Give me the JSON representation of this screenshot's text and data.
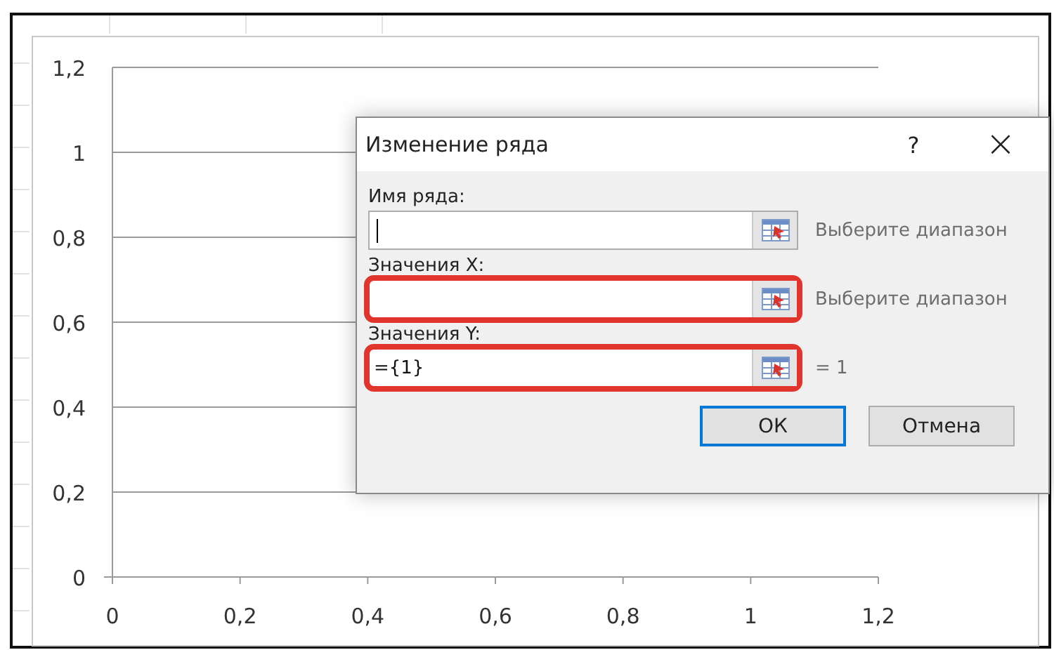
{
  "chart": {
    "chart_data": {
      "type": "scatter",
      "grid": true,
      "xlim": [
        0,
        1.2
      ],
      "ylim": [
        0,
        1.2
      ],
      "xticks": [
        {
          "value": 0,
          "label": "0"
        },
        {
          "value": 0.2,
          "label": "0,2"
        },
        {
          "value": 0.4,
          "label": "0,4"
        },
        {
          "value": 0.6,
          "label": "0,6"
        },
        {
          "value": 0.8,
          "label": "0,8"
        },
        {
          "value": 1,
          "label": "1"
        },
        {
          "value": 1.2,
          "label": "1,2"
        }
      ],
      "yticks": [
        {
          "value": 0,
          "label": "0"
        },
        {
          "value": 0.2,
          "label": "0,2"
        },
        {
          "value": 0.4,
          "label": "0,4"
        },
        {
          "value": 0.6,
          "label": "0,6"
        },
        {
          "value": 0.8,
          "label": "0,8"
        },
        {
          "value": 1,
          "label": "1"
        },
        {
          "value": 1.2,
          "label": "1,2"
        }
      ]
    }
  },
  "dialog": {
    "title": "Изменение ряда",
    "help": "?",
    "close": "×",
    "fields": [
      {
        "label": "Имя ряда:",
        "focused": true,
        "highlighted": false,
        "hint": "Выберите диапазон"
      },
      {
        "label": "Значения X:",
        "focused": false,
        "highlighted": true,
        "hint": "Выберите диапазон"
      },
      {
        "label": "Значения Y:",
        "value": "={1}",
        "focused": false,
        "highlighted": true,
        "hint": "= 1"
      }
    ],
    "buttons": [
      {
        "label": "ОК",
        "default": true
      },
      {
        "label": "Отмена",
        "default": false
      }
    ]
  }
}
